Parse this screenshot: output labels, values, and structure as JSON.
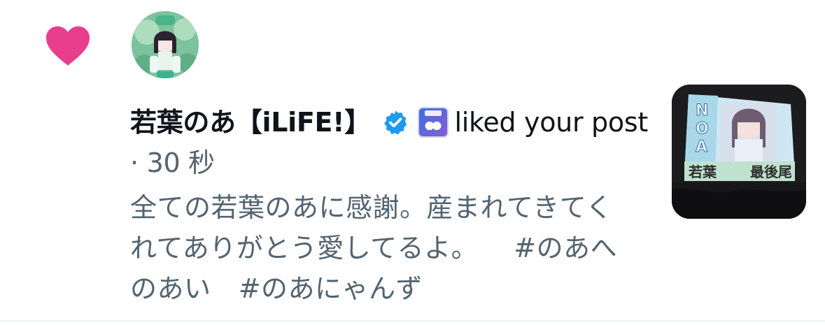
{
  "notification": {
    "user_name": "若葉のあ【iLiFE!】",
    "action_text": "liked your post",
    "separator": "·",
    "time": "30 秒",
    "post_text": "全ての若葉のあに感謝。産まれてきてくれてありがとう愛してるよ。",
    "hashtags": [
      "#のあへのあい",
      "#のあにゃんず"
    ],
    "icons": {
      "like": "heart-icon",
      "verified": "verified-badge-icon",
      "affiliate": "affiliate-badge-icon"
    },
    "thumbnail_text": {
      "vertical": "NOA",
      "banner": "若葉",
      "banner_right": "最後尾"
    }
  },
  "colors": {
    "heart": "#e83e8c",
    "verified": "#1d9bf0",
    "primary_text": "#0f1419",
    "secondary_text": "#536471"
  }
}
